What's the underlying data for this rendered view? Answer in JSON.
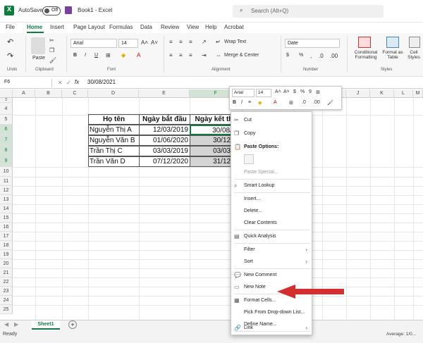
{
  "titlebar": {
    "autosave_label": "AutoSave",
    "autosave_state": "Off",
    "doc_title": "Book1 - Excel",
    "search_placeholder": "Search (Alt+Q)"
  },
  "menu": [
    "File",
    "Home",
    "Insert",
    "Page Layout",
    "Formulas",
    "Data",
    "Review",
    "View",
    "Help",
    "Acrobat"
  ],
  "ribbon": {
    "undo_group": "Undo",
    "clipboard": {
      "label": "Clipboard",
      "paste": "Paste"
    },
    "font": {
      "label": "Font",
      "family": "Arial",
      "size": "14",
      "bold": "B",
      "italic": "I",
      "underline": "U"
    },
    "alignment": {
      "label": "Alignment",
      "wrap": "Wrap Text",
      "merge": "Merge & Center"
    },
    "number": {
      "label": "Number",
      "format": "Date",
      "currency": "$",
      "percent": "%"
    },
    "styles": {
      "label": "Styles",
      "conditional": "Conditional Formatting",
      "format_table": "Format as Table",
      "cell_styles": "Cell Styles"
    }
  },
  "formula_bar": {
    "name_box": "F6",
    "fx": "fx",
    "value": "30/08/2021"
  },
  "columns": [
    "A",
    "B",
    "C",
    "D",
    "E",
    "F",
    "G",
    "H",
    "I",
    "J",
    "K",
    "L",
    "M"
  ],
  "rows": [
    "3",
    "4",
    "5",
    "6",
    "7",
    "8",
    "9",
    "10",
    "11",
    "12",
    "13",
    "14",
    "15",
    "16",
    "17",
    "18",
    "19",
    "20",
    "21",
    "22",
    "23",
    "24",
    "25",
    "26",
    "27",
    "28"
  ],
  "table": {
    "headers": [
      "Họ tên",
      "Ngày bắt đầu",
      "Ngày kết thú"
    ],
    "rows": [
      [
        "Nguyễn Thị A",
        "12/03/2019",
        "30/08/20"
      ],
      [
        "Nguyễn Văn B",
        "01/06/2020",
        "30/12/20"
      ],
      [
        "Trần Thị C",
        "03/03/2019",
        "03/03/20"
      ],
      [
        "Trần Văn D",
        "07/12/2020",
        "31/12/20"
      ]
    ]
  },
  "mini_toolbar": {
    "font": "Arial",
    "size": "14"
  },
  "context_menu": {
    "items": [
      {
        "label": "Cut",
        "icon": "scissors-icon",
        "disabled": false
      },
      {
        "label": "Copy",
        "icon": "copy-icon",
        "disabled": false
      },
      {
        "label": "Paste Options:",
        "icon": "paste-icon",
        "disabled": false,
        "bold": true
      },
      {
        "label": "Paste Special...",
        "icon": "",
        "disabled": true
      },
      {
        "label": "Smart Lookup",
        "icon": "search-icon",
        "disabled": false
      },
      {
        "label": "Insert...",
        "icon": "",
        "disabled": false
      },
      {
        "label": "Delete...",
        "icon": "",
        "disabled": false
      },
      {
        "label": "Clear Contents",
        "icon": "",
        "disabled": false
      },
      {
        "label": "Quick Analysis",
        "icon": "quick-analysis-icon",
        "disabled": false
      },
      {
        "label": "Filter",
        "icon": "",
        "disabled": false,
        "submenu": true
      },
      {
        "label": "Sort",
        "icon": "",
        "disabled": false,
        "submenu": true
      },
      {
        "label": "New Comment",
        "icon": "comment-icon",
        "disabled": false
      },
      {
        "label": "New Note",
        "icon": "note-icon",
        "disabled": false
      },
      {
        "label": "Format Cells...",
        "icon": "format-cells-icon",
        "disabled": false
      },
      {
        "label": "Pick From Drop-down List...",
        "icon": "",
        "disabled": false
      },
      {
        "label": "Define Name...",
        "icon": "",
        "disabled": false
      },
      {
        "label": "Link",
        "icon": "link-icon",
        "disabled": false,
        "submenu": true
      }
    ]
  },
  "status": {
    "ready": "Ready",
    "average": "Average: 1/0...",
    "sheet_tab": "Sheet1",
    "add_sheet": "+"
  },
  "colors": {
    "accent": "#107c41",
    "arrow": "#d32f2f",
    "selection": "#d3e3d6"
  }
}
